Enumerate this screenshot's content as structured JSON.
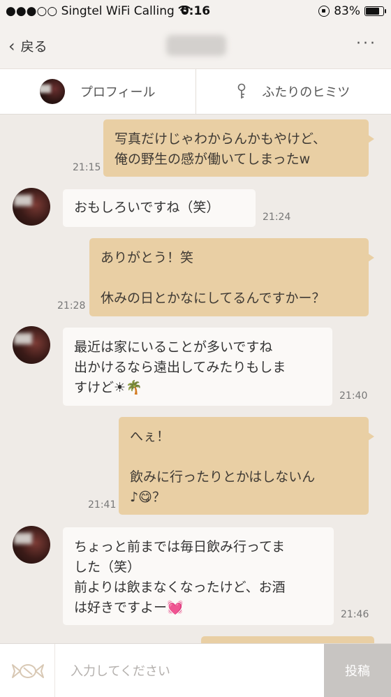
{
  "status_bar": {
    "signal": "●●●○○",
    "carrier": "Singtel WiFi Calling",
    "time": "0:16",
    "battery": "83%"
  },
  "nav": {
    "back_label": "戻る",
    "more_label": "···"
  },
  "tabs": {
    "profile": "プロフィール",
    "secret": "ふたりのヒミツ"
  },
  "messages": [
    {
      "side": "sent",
      "text": "写真だけじゃわからんかもやけど、\n俺の野生の感が働いてしまったw",
      "time": "21:15"
    },
    {
      "side": "received",
      "text": "おもしろいですね（笑）",
      "time": "21:24"
    },
    {
      "side": "sent",
      "text": "ありがとう！笑\n\n休みの日とかなにしてるんですかー？",
      "time": "21:28"
    },
    {
      "side": "received",
      "text": "最近は家にいることが多いですね\n出かけるなら遠出してみたりもしま\nすけど",
      "emoji": "☀🌴",
      "time": "21:40"
    },
    {
      "side": "sent",
      "text": "へぇ！\n\n飲みに行ったりとかはしないん\n♪",
      "emoji": "😋",
      "suffix": "？",
      "time": "21:41"
    },
    {
      "side": "received",
      "text": "ちょっと前までは毎日飲み行ってま\nした（笑）\n前よりは飲まなくなったけど、お酒\nは好きですよー",
      "emoji": "💓",
      "time": "21:46"
    }
  ],
  "input": {
    "placeholder": "入力してください",
    "post_label": "投稿"
  },
  "colors": {
    "sent_bubble": "#e9cfa4",
    "received_bubble": "#fbf9f7",
    "background": "#efebe7"
  }
}
